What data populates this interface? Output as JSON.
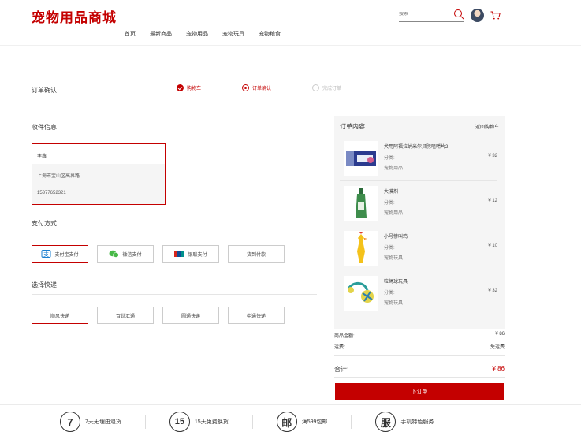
{
  "header": {
    "logo": "宠物用品商城",
    "nav": [
      "首页",
      "最新商品",
      "宠物用品",
      "宠物玩具",
      "宠物粮食"
    ],
    "search_placeholder": "搜索"
  },
  "order": {
    "title": "订单确认",
    "steps": [
      {
        "label": "购物车",
        "state": "done"
      },
      {
        "label": "订单确认",
        "state": "active"
      },
      {
        "label": "完成订单",
        "state": "pending"
      }
    ]
  },
  "address": {
    "title": "收件信息",
    "name": "李鑫",
    "street": "上海市宝山区高界路",
    "phone": "15377652321"
  },
  "payment": {
    "title": "支付方式",
    "options": [
      "支付宝支付",
      "微信支付",
      "银联支付",
      "货到付款"
    ],
    "selected": 0
  },
  "shipping": {
    "title": "选择快递",
    "options": [
      "顺风快递",
      "百世汇通",
      "圆通快递",
      "中通快递"
    ],
    "selected": 0
  },
  "summary": {
    "title": "订单内容",
    "back_link": "返回购物车",
    "items": [
      {
        "name": "犬用阿福拉纳米尔贝肟咀嚼片2",
        "category_label": "分类:",
        "category": "宠物用品",
        "price": "¥ 32"
      },
      {
        "name": "大漠剂",
        "category_label": "分类:",
        "category": "宠物用品",
        "price": "¥ 12"
      },
      {
        "name": "小号惨叫鸡",
        "category_label": "分类:",
        "category": "宠物玩具",
        "price": "¥ 10"
      },
      {
        "name": "粒绳球玩具",
        "category_label": "分类:",
        "category": "宠物玩具",
        "price": "¥ 32"
      }
    ],
    "goods_total_label": "商品金额:",
    "goods_total": "¥ 86",
    "shipping_label": "运费:",
    "shipping_value": "免运费",
    "total_label": "合计:",
    "total": "¥ 86",
    "submit": "下订单"
  },
  "footer": [
    {
      "glyph": "7",
      "label": "7天无理由退货"
    },
    {
      "glyph": "15",
      "label": "15天免费换货"
    },
    {
      "glyph": "邮",
      "label": "满599包邮"
    },
    {
      "glyph": "服",
      "label": "手机特色服务"
    }
  ],
  "colors": {
    "brand": "#c40000",
    "panel": "#f5f5f5"
  }
}
